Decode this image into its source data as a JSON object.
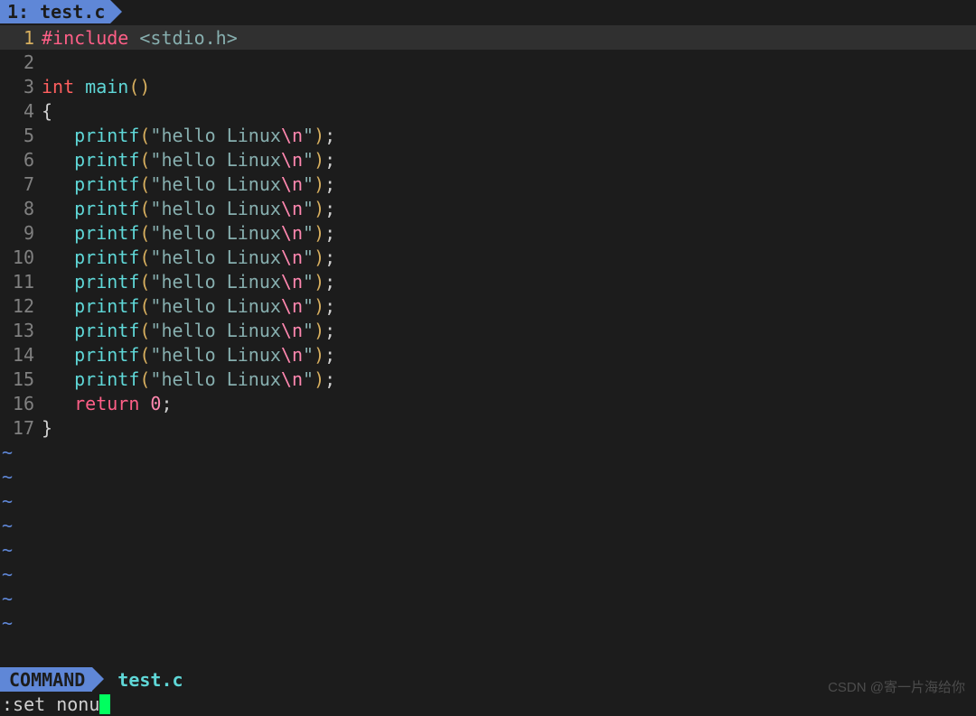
{
  "tab": {
    "index": "1",
    "name": "test.c"
  },
  "code": {
    "lines": [
      {
        "n": "1",
        "tokens": [
          {
            "t": "#include",
            "c": "tok-preproc"
          },
          {
            "t": " ",
            "c": ""
          },
          {
            "t": "<stdio.h>",
            "c": "tok-string"
          }
        ],
        "cursor": true
      },
      {
        "n": "2",
        "tokens": []
      },
      {
        "n": "3",
        "tokens": [
          {
            "t": "int",
            "c": "tok-type"
          },
          {
            "t": " ",
            "c": ""
          },
          {
            "t": "main",
            "c": "tok-func"
          },
          {
            "t": "()",
            "c": "tok-paren"
          }
        ]
      },
      {
        "n": "4",
        "tokens": [
          {
            "t": "{",
            "c": "tok-brace"
          }
        ]
      },
      {
        "n": "5",
        "tokens": [
          {
            "t": "   ",
            "c": ""
          },
          {
            "t": "printf",
            "c": "tok-func"
          },
          {
            "t": "(",
            "c": "tok-paren"
          },
          {
            "t": "\"hello Linux",
            "c": "tok-string"
          },
          {
            "t": "\\n",
            "c": "tok-escape"
          },
          {
            "t": "\"",
            "c": "tok-string"
          },
          {
            "t": ")",
            "c": "tok-paren"
          },
          {
            "t": ";",
            "c": "tok-punct"
          }
        ]
      },
      {
        "n": "6",
        "tokens": [
          {
            "t": "   ",
            "c": ""
          },
          {
            "t": "printf",
            "c": "tok-func"
          },
          {
            "t": "(",
            "c": "tok-paren"
          },
          {
            "t": "\"hello Linux",
            "c": "tok-string"
          },
          {
            "t": "\\n",
            "c": "tok-escape"
          },
          {
            "t": "\"",
            "c": "tok-string"
          },
          {
            "t": ")",
            "c": "tok-paren"
          },
          {
            "t": ";",
            "c": "tok-punct"
          }
        ]
      },
      {
        "n": "7",
        "tokens": [
          {
            "t": "   ",
            "c": ""
          },
          {
            "t": "printf",
            "c": "tok-func"
          },
          {
            "t": "(",
            "c": "tok-paren"
          },
          {
            "t": "\"hello Linux",
            "c": "tok-string"
          },
          {
            "t": "\\n",
            "c": "tok-escape"
          },
          {
            "t": "\"",
            "c": "tok-string"
          },
          {
            "t": ")",
            "c": "tok-paren"
          },
          {
            "t": ";",
            "c": "tok-punct"
          }
        ]
      },
      {
        "n": "8",
        "tokens": [
          {
            "t": "   ",
            "c": ""
          },
          {
            "t": "printf",
            "c": "tok-func"
          },
          {
            "t": "(",
            "c": "tok-paren"
          },
          {
            "t": "\"hello Linux",
            "c": "tok-string"
          },
          {
            "t": "\\n",
            "c": "tok-escape"
          },
          {
            "t": "\"",
            "c": "tok-string"
          },
          {
            "t": ")",
            "c": "tok-paren"
          },
          {
            "t": ";",
            "c": "tok-punct"
          }
        ]
      },
      {
        "n": "9",
        "tokens": [
          {
            "t": "   ",
            "c": ""
          },
          {
            "t": "printf",
            "c": "tok-func"
          },
          {
            "t": "(",
            "c": "tok-paren"
          },
          {
            "t": "\"hello Linux",
            "c": "tok-string"
          },
          {
            "t": "\\n",
            "c": "tok-escape"
          },
          {
            "t": "\"",
            "c": "tok-string"
          },
          {
            "t": ")",
            "c": "tok-paren"
          },
          {
            "t": ";",
            "c": "tok-punct"
          }
        ]
      },
      {
        "n": "10",
        "tokens": [
          {
            "t": "   ",
            "c": ""
          },
          {
            "t": "printf",
            "c": "tok-func"
          },
          {
            "t": "(",
            "c": "tok-paren"
          },
          {
            "t": "\"hello Linux",
            "c": "tok-string"
          },
          {
            "t": "\\n",
            "c": "tok-escape"
          },
          {
            "t": "\"",
            "c": "tok-string"
          },
          {
            "t": ")",
            "c": "tok-paren"
          },
          {
            "t": ";",
            "c": "tok-punct"
          }
        ]
      },
      {
        "n": "11",
        "tokens": [
          {
            "t": "   ",
            "c": ""
          },
          {
            "t": "printf",
            "c": "tok-func"
          },
          {
            "t": "(",
            "c": "tok-paren"
          },
          {
            "t": "\"hello Linux",
            "c": "tok-string"
          },
          {
            "t": "\\n",
            "c": "tok-escape"
          },
          {
            "t": "\"",
            "c": "tok-string"
          },
          {
            "t": ")",
            "c": "tok-paren"
          },
          {
            "t": ";",
            "c": "tok-punct"
          }
        ]
      },
      {
        "n": "12",
        "tokens": [
          {
            "t": "   ",
            "c": ""
          },
          {
            "t": "printf",
            "c": "tok-func"
          },
          {
            "t": "(",
            "c": "tok-paren"
          },
          {
            "t": "\"hello Linux",
            "c": "tok-string"
          },
          {
            "t": "\\n",
            "c": "tok-escape"
          },
          {
            "t": "\"",
            "c": "tok-string"
          },
          {
            "t": ")",
            "c": "tok-paren"
          },
          {
            "t": ";",
            "c": "tok-punct"
          }
        ]
      },
      {
        "n": "13",
        "tokens": [
          {
            "t": "   ",
            "c": ""
          },
          {
            "t": "printf",
            "c": "tok-func"
          },
          {
            "t": "(",
            "c": "tok-paren"
          },
          {
            "t": "\"hello Linux",
            "c": "tok-string"
          },
          {
            "t": "\\n",
            "c": "tok-escape"
          },
          {
            "t": "\"",
            "c": "tok-string"
          },
          {
            "t": ")",
            "c": "tok-paren"
          },
          {
            "t": ";",
            "c": "tok-punct"
          }
        ]
      },
      {
        "n": "14",
        "tokens": [
          {
            "t": "   ",
            "c": ""
          },
          {
            "t": "printf",
            "c": "tok-func"
          },
          {
            "t": "(",
            "c": "tok-paren"
          },
          {
            "t": "\"hello Linux",
            "c": "tok-string"
          },
          {
            "t": "\\n",
            "c": "tok-escape"
          },
          {
            "t": "\"",
            "c": "tok-string"
          },
          {
            "t": ")",
            "c": "tok-paren"
          },
          {
            "t": ";",
            "c": "tok-punct"
          }
        ]
      },
      {
        "n": "15",
        "tokens": [
          {
            "t": "   ",
            "c": ""
          },
          {
            "t": "printf",
            "c": "tok-func"
          },
          {
            "t": "(",
            "c": "tok-paren"
          },
          {
            "t": "\"hello Linux",
            "c": "tok-string"
          },
          {
            "t": "\\n",
            "c": "tok-escape"
          },
          {
            "t": "\"",
            "c": "tok-string"
          },
          {
            "t": ")",
            "c": "tok-paren"
          },
          {
            "t": ";",
            "c": "tok-punct"
          }
        ]
      },
      {
        "n": "16",
        "tokens": [
          {
            "t": "   ",
            "c": ""
          },
          {
            "t": "return",
            "c": "tok-keyword"
          },
          {
            "t": " ",
            "c": ""
          },
          {
            "t": "0",
            "c": "tok-number"
          },
          {
            "t": ";",
            "c": "tok-punct"
          }
        ]
      },
      {
        "n": "17",
        "tokens": [
          {
            "t": "}",
            "c": "tok-brace"
          }
        ]
      }
    ],
    "tilde_count": 8,
    "tilde_char": "~"
  },
  "status": {
    "mode": "COMMAND",
    "filename": "test.c"
  },
  "cmdline": {
    "text": ":set nonu"
  },
  "watermark": "CSDN @寄一片海给你"
}
